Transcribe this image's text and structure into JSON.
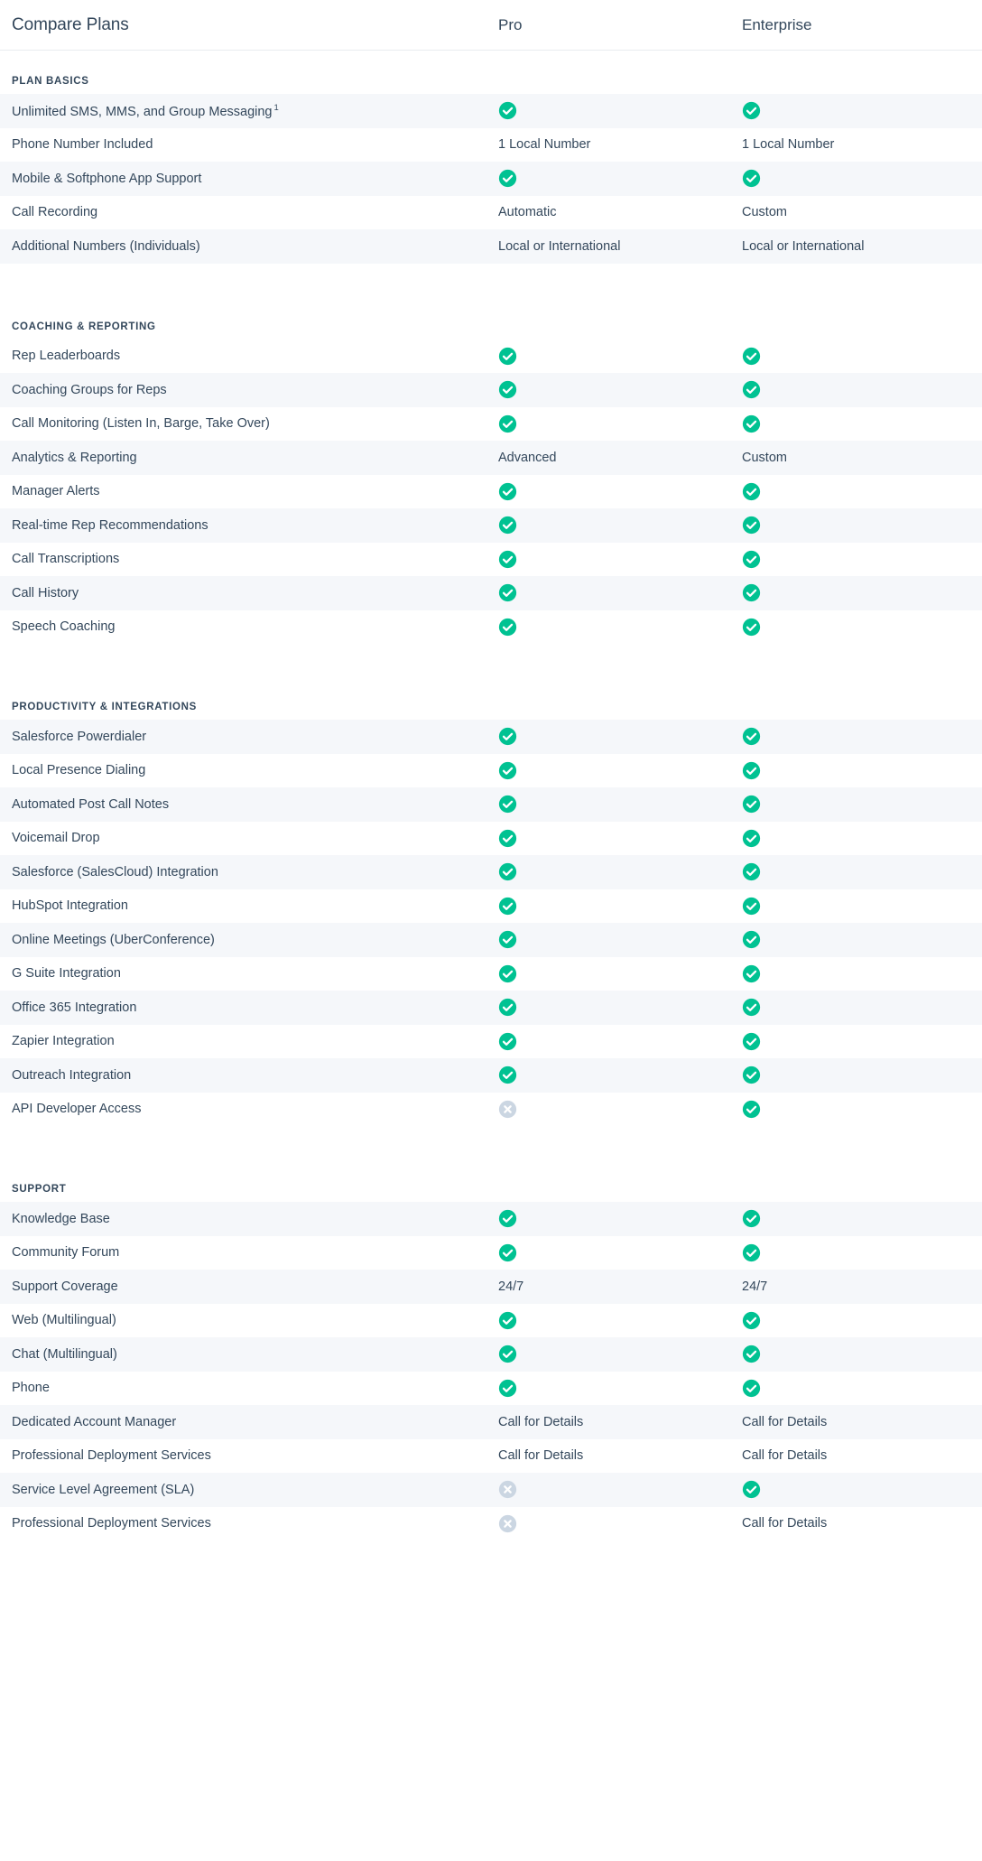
{
  "colors": {
    "text_navy": "#33475b",
    "check_teal": "#00c292",
    "cross_grey": "#cbd6e2",
    "row_alt_bg": "#f5f7fa",
    "row_bg": "#ffffff",
    "divider": "#e8ebef"
  },
  "header": {
    "title": "Compare Plans",
    "columns": [
      {
        "label": "Pro"
      },
      {
        "label": "Enterprise"
      }
    ]
  },
  "icons": {
    "check": "check-circle-icon",
    "cross": "cross-circle-icon"
  },
  "sections": [
    {
      "label": "PLAN BASICS",
      "rows": [
        {
          "feature": "Unlimited SMS, MMS, and Group Messaging",
          "footnote": "1",
          "pro": "check",
          "enterprise": "check"
        },
        {
          "feature": "Phone Number Included",
          "pro": "1 Local Number",
          "enterprise": "1 Local Number"
        },
        {
          "feature": "Mobile & Softphone App Support",
          "pro": "check",
          "enterprise": "check"
        },
        {
          "feature": "Call Recording",
          "pro": "Automatic",
          "enterprise": "Custom"
        },
        {
          "feature": "Additional Numbers (Individuals)",
          "pro": "Local or International",
          "enterprise": "Local or International"
        }
      ]
    },
    {
      "label": "COACHING & REPORTING",
      "rows": [
        {
          "feature": "Rep Leaderboards",
          "pro": "check",
          "enterprise": "check"
        },
        {
          "feature": "Coaching Groups for Reps",
          "pro": "check",
          "enterprise": "check"
        },
        {
          "feature": "Call Monitoring (Listen In, Barge, Take Over)",
          "pro": "check",
          "enterprise": "check"
        },
        {
          "feature": "Analytics & Reporting",
          "pro": "Advanced",
          "enterprise": "Custom"
        },
        {
          "feature": "Manager Alerts",
          "pro": "check",
          "enterprise": "check"
        },
        {
          "feature": "Real-time Rep Recommendations",
          "pro": "check",
          "enterprise": "check"
        },
        {
          "feature": "Call Transcriptions",
          "pro": "check",
          "enterprise": "check"
        },
        {
          "feature": "Call History",
          "pro": "check",
          "enterprise": "check"
        },
        {
          "feature": "Speech Coaching",
          "pro": "check",
          "enterprise": "check"
        }
      ]
    },
    {
      "label": "PRODUCTIVITY & INTEGRATIONS",
      "rows": [
        {
          "feature": "Salesforce Powerdialer",
          "pro": "check",
          "enterprise": "check"
        },
        {
          "feature": "Local Presence Dialing",
          "pro": "check",
          "enterprise": "check"
        },
        {
          "feature": "Automated Post Call Notes",
          "pro": "check",
          "enterprise": "check"
        },
        {
          "feature": "Voicemail Drop",
          "pro": "check",
          "enterprise": "check"
        },
        {
          "feature": "Salesforce (SalesCloud) Integration",
          "pro": "check",
          "enterprise": "check"
        },
        {
          "feature": "HubSpot Integration",
          "pro": "check",
          "enterprise": "check"
        },
        {
          "feature": "Online Meetings (UberConference)",
          "pro": "check",
          "enterprise": "check"
        },
        {
          "feature": "G Suite Integration",
          "pro": "check",
          "enterprise": "check"
        },
        {
          "feature": "Office 365 Integration",
          "pro": "check",
          "enterprise": "check"
        },
        {
          "feature": "Zapier Integration",
          "pro": "check",
          "enterprise": "check"
        },
        {
          "feature": "Outreach Integration",
          "pro": "check",
          "enterprise": "check"
        },
        {
          "feature": "API Developer Access",
          "pro": "cross",
          "enterprise": "check"
        }
      ]
    },
    {
      "label": "SUPPORT",
      "rows": [
        {
          "feature": "Knowledge Base",
          "pro": "check",
          "enterprise": "check"
        },
        {
          "feature": "Community Forum",
          "pro": "check",
          "enterprise": "check"
        },
        {
          "feature": "Support Coverage",
          "pro": "24/7",
          "enterprise": "24/7"
        },
        {
          "feature": "Web (Multilingual)",
          "pro": "check",
          "enterprise": "check"
        },
        {
          "feature": "Chat (Multilingual)",
          "pro": "check",
          "enterprise": "check"
        },
        {
          "feature": "Phone",
          "pro": "check",
          "enterprise": "check"
        },
        {
          "feature": "Dedicated Account Manager",
          "pro": "Call for Details",
          "enterprise": "Call for Details"
        },
        {
          "feature": "Professional Deployment Services",
          "pro": "Call for Details",
          "enterprise": "Call for Details"
        },
        {
          "feature": "Service Level Agreement (SLA)",
          "pro": "cross",
          "enterprise": "check"
        },
        {
          "feature": "Professional Deployment Services",
          "pro": "cross",
          "enterprise": "Call for Details"
        }
      ]
    }
  ]
}
